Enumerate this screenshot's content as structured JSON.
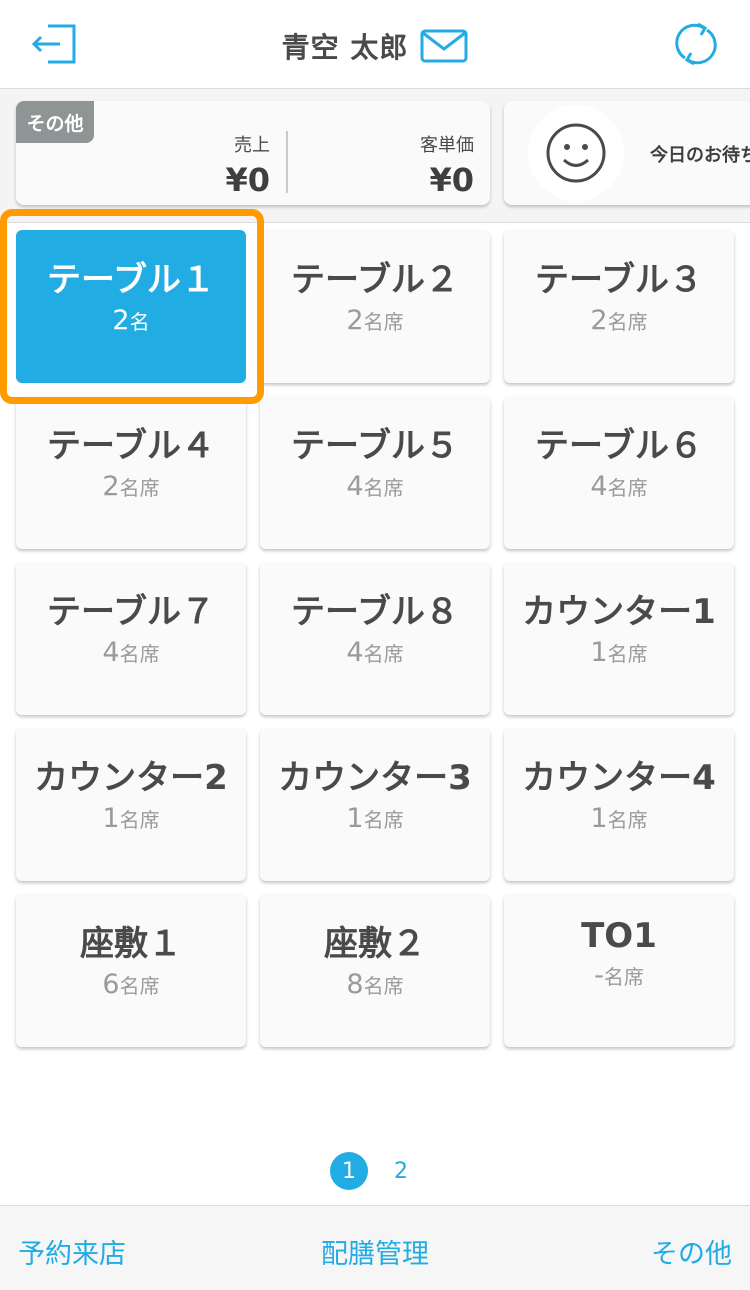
{
  "header": {
    "user_name": "青空 太郎",
    "left_icon": "logout-icon",
    "mail_icon": "mail-icon",
    "right_icon": "refresh-icon"
  },
  "summary": {
    "badge": "その他",
    "sales_label": "売上",
    "sales_value": "¥0",
    "avg_label": "客単価",
    "avg_value": "¥0",
    "waiting_text": "今日のお待ち",
    "waiting_icon": "smiley-icon"
  },
  "tables": [
    {
      "name": "テーブル１",
      "count": "2",
      "unit": "名",
      "active": true
    },
    {
      "name": "テーブル２",
      "count": "2",
      "unit": "名席",
      "active": false
    },
    {
      "name": "テーブル３",
      "count": "2",
      "unit": "名席",
      "active": false
    },
    {
      "name": "テーブル４",
      "count": "2",
      "unit": "名席",
      "active": false
    },
    {
      "name": "テーブル５",
      "count": "4",
      "unit": "名席",
      "active": false
    },
    {
      "name": "テーブル６",
      "count": "4",
      "unit": "名席",
      "active": false
    },
    {
      "name": "テーブル７",
      "count": "4",
      "unit": "名席",
      "active": false
    },
    {
      "name": "テーブル８",
      "count": "4",
      "unit": "名席",
      "active": false
    },
    {
      "name": "カウンター1",
      "count": "1",
      "unit": "名席",
      "active": false
    },
    {
      "name": "カウンター2",
      "count": "1",
      "unit": "名席",
      "active": false
    },
    {
      "name": "カウンター3",
      "count": "1",
      "unit": "名席",
      "active": false
    },
    {
      "name": "カウンター4",
      "count": "1",
      "unit": "名席",
      "active": false
    },
    {
      "name": "座敷１",
      "count": "6",
      "unit": "名席",
      "active": false
    },
    {
      "name": "座敷２",
      "count": "8",
      "unit": "名席",
      "active": false
    },
    {
      "name": "TO1",
      "count": "-",
      "unit": "名席",
      "active": false
    }
  ],
  "pagination": {
    "pages": [
      "1",
      "2"
    ],
    "current": "1"
  },
  "footer": {
    "reservation": "予約来店",
    "serving": "配膳管理",
    "other": "その他"
  },
  "colors": {
    "accent": "#21ace4",
    "highlight": "#ff9a00",
    "badge": "#8f9595"
  }
}
